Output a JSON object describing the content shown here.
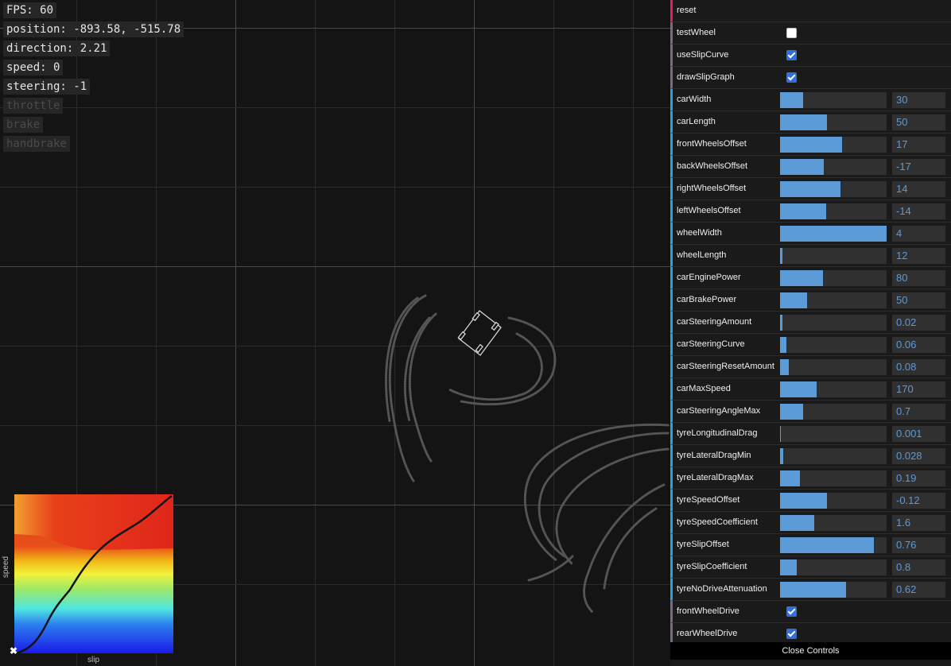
{
  "hud": {
    "fps": "FPS: 60",
    "position": "position: -893.58, -515.78",
    "direction": "direction: 2.21",
    "speed": "speed: 0",
    "steering": "steering: -1",
    "throttle": "throttle",
    "brake": "brake",
    "handbrake": "handbrake"
  },
  "slip_graph": {
    "x_label": "slip",
    "y_label": "speed",
    "close_glyph": "✖"
  },
  "controls": {
    "reset": "reset",
    "toggles": [
      {
        "label": "testWheel",
        "checked": false
      },
      {
        "label": "useSlipCurve",
        "checked": true
      },
      {
        "label": "drawSlipGraph",
        "checked": true
      }
    ],
    "params": [
      {
        "label": "carWidth",
        "value": "30",
        "fill": 0.22
      },
      {
        "label": "carLength",
        "value": "50",
        "fill": 0.44
      },
      {
        "label": "frontWheelsOffset",
        "value": "17",
        "fill": 0.58
      },
      {
        "label": "backWheelsOffset",
        "value": "-17",
        "fill": 0.41
      },
      {
        "label": "rightWheelsOffset",
        "value": "14",
        "fill": 0.57
      },
      {
        "label": "leftWheelsOffset",
        "value": "-14",
        "fill": 0.43
      },
      {
        "label": "wheelWidth",
        "value": "4",
        "fill": 1.0
      },
      {
        "label": "wheelLength",
        "value": "12",
        "fill": 0.02
      },
      {
        "label": "carEnginePower",
        "value": "80",
        "fill": 0.4
      },
      {
        "label": "carBrakePower",
        "value": "50",
        "fill": 0.25
      },
      {
        "label": "carSteeringAmount",
        "value": "0.02",
        "fill": 0.02
      },
      {
        "label": "carSteeringCurve",
        "value": "0.06",
        "fill": 0.06
      },
      {
        "label": "carSteeringResetAmount",
        "value": "0.08",
        "fill": 0.08
      },
      {
        "label": "carMaxSpeed",
        "value": "170",
        "fill": 0.34
      },
      {
        "label": "carSteeringAngleMax",
        "value": "0.7",
        "fill": 0.22
      },
      {
        "label": "tyreLongitudinalDrag",
        "value": "0.001",
        "fill": 0.005
      },
      {
        "label": "tyreLateralDragMin",
        "value": "0.028",
        "fill": 0.028
      },
      {
        "label": "tyreLateralDragMax",
        "value": "0.19",
        "fill": 0.19
      },
      {
        "label": "tyreSpeedOffset",
        "value": "-0.12",
        "fill": 0.44
      },
      {
        "label": "tyreSpeedCoefficient",
        "value": "1.6",
        "fill": 0.32
      },
      {
        "label": "tyreSlipOffset",
        "value": "0.76",
        "fill": 0.88
      },
      {
        "label": "tyreSlipCoefficient",
        "value": "0.8",
        "fill": 0.16
      },
      {
        "label": "tyreNoDriveAttenuation",
        "value": "0.62",
        "fill": 0.62
      }
    ],
    "drive_toggles": [
      {
        "label": "frontWheelDrive",
        "checked": true
      },
      {
        "label": "rearWheelDrive",
        "checked": true
      }
    ],
    "close_label": "Close Controls"
  },
  "colors": {
    "background": "#141414",
    "slider_fill": "#5b9bd8",
    "number_text": "#5b9bd8",
    "checkbox_on": "#2f6fe0",
    "button_accent": "#e61d5f",
    "number_accent": "#2fa1d6",
    "bool_accent": "#806787"
  }
}
